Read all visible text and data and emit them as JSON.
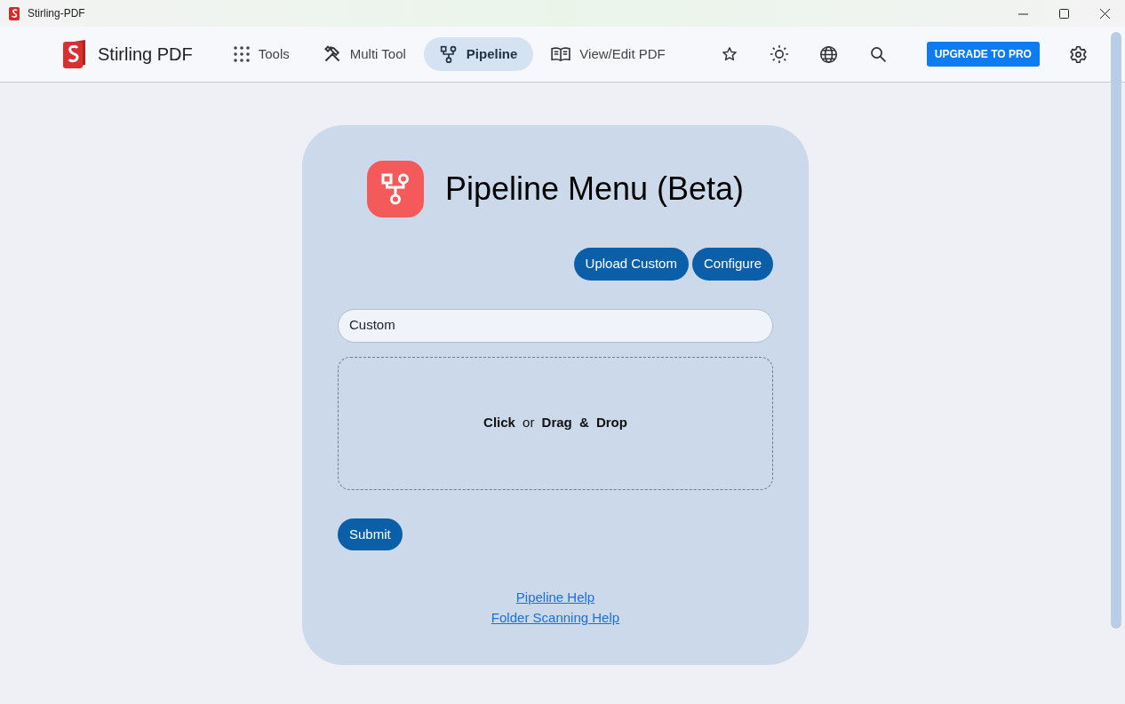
{
  "window": {
    "title": "Stirling-PDF"
  },
  "navbar": {
    "brand": "Stirling PDF",
    "items": [
      {
        "label": "Tools",
        "selected": false
      },
      {
        "label": "Multi Tool",
        "selected": false
      },
      {
        "label": "Pipeline",
        "selected": true
      },
      {
        "label": "View/Edit PDF",
        "selected": false
      }
    ],
    "upgrade_button": "UPGRADE TO PRO"
  },
  "card": {
    "title": "Pipeline Menu (Beta)",
    "buttons": [
      "Upload Custom",
      "Configure"
    ],
    "pipeline_select": {
      "value": "Custom"
    },
    "dropzone": "**Click** or **Drag & Drop**",
    "submit": "Submit",
    "links": [
      "Pipeline Help",
      "Folder Scanning Help"
    ]
  }
}
